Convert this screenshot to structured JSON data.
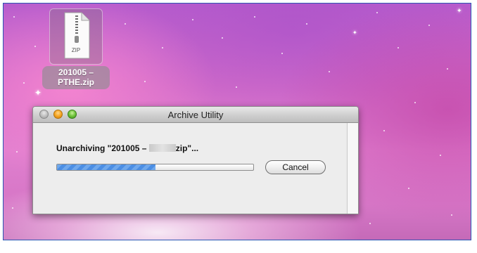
{
  "desktop": {
    "file_icon_label": "ZIP",
    "file_name": "201005 –\nPTHE.zip"
  },
  "window": {
    "title": "Archive Utility",
    "status_prefix": "Unarchiving \"201005 – ",
    "status_suffix": "zip\"...",
    "progress": 0.5,
    "cancel_label": "Cancel"
  },
  "icons": [
    "zip-file-icon",
    "close-button",
    "minimize-button",
    "zoom-button"
  ],
  "colors": {
    "progress_fill": "#4b8ee4",
    "desktop_magenta": "#d676c6",
    "minimize_orange": "#f5a623",
    "zoom_green": "#6fc43b"
  }
}
